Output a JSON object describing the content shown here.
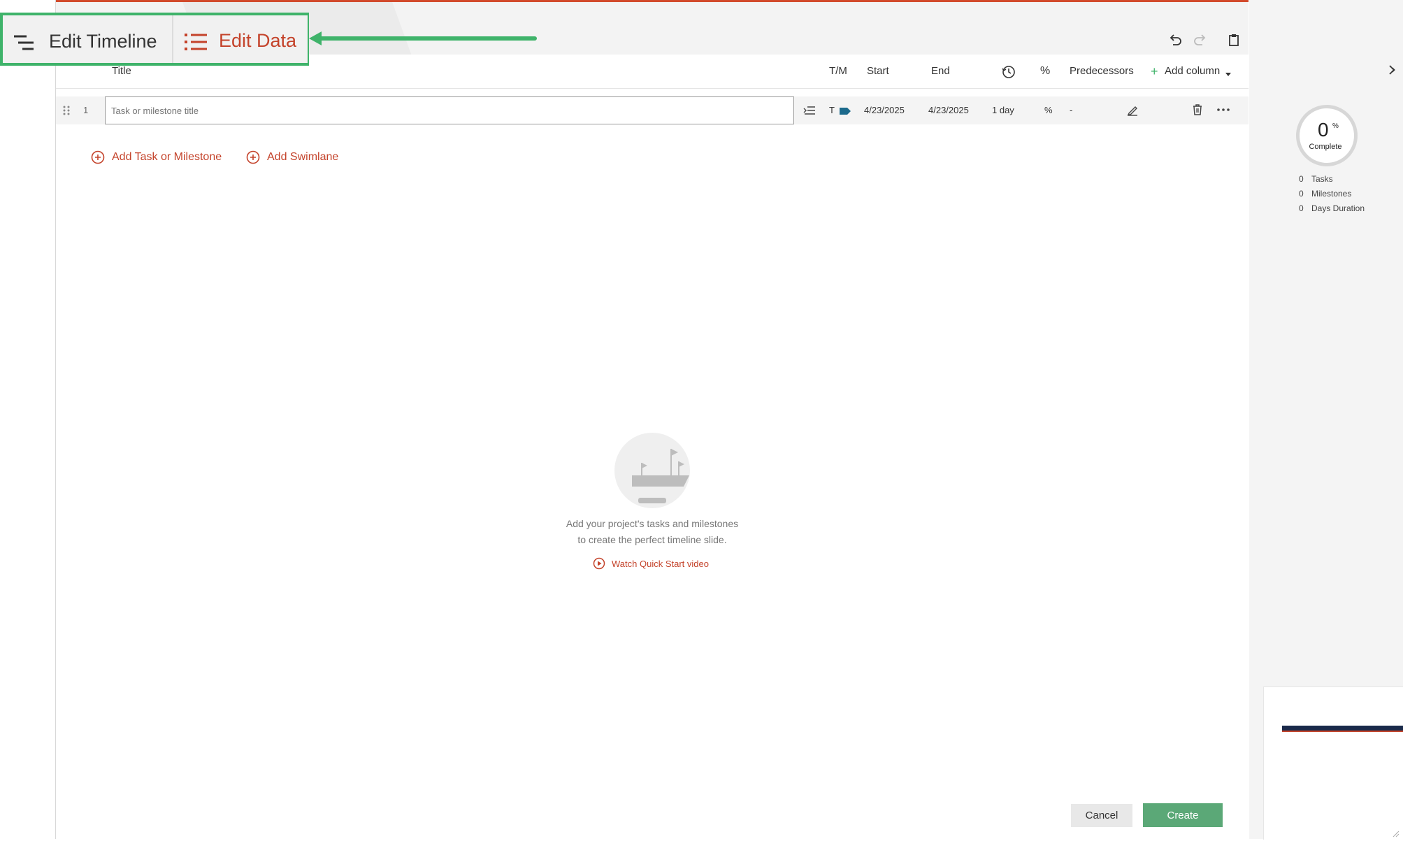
{
  "tabs": {
    "timeline_label": "Edit Timeline",
    "data_label": "Edit Data"
  },
  "columns": {
    "title": "Title",
    "tm": "T/M",
    "start": "Start",
    "end": "End",
    "percent": "%",
    "predecessors": "Predecessors",
    "add_column": "Add column"
  },
  "rows": [
    {
      "index": "1",
      "placeholder": "Task or milestone title",
      "type": "T",
      "start": "4/23/2025",
      "end": "4/23/2025",
      "duration": "1 day",
      "percent": "%",
      "predecessors": "-"
    }
  ],
  "actions": {
    "add_task": "Add Task or Milestone",
    "add_swimlane": "Add Swimlane"
  },
  "empty_state": {
    "line1": "Add your project's tasks and milestones",
    "line2": "to create the perfect timeline slide.",
    "video_link": "Watch Quick Start video"
  },
  "footer": {
    "cancel": "Cancel",
    "create": "Create"
  },
  "summary": {
    "percent_value": "0",
    "percent_symbol": "%",
    "complete_label": "Complete",
    "tasks_count": "0",
    "tasks_label": "Tasks",
    "milestones_count": "0",
    "milestones_label": "Milestones",
    "days_count": "0",
    "days_label": "Days Duration"
  },
  "colors": {
    "accent_red": "#c4432b",
    "highlight_green": "#3fb36a",
    "create_green": "#5ba877",
    "type_blue": "#1c6a8c"
  }
}
